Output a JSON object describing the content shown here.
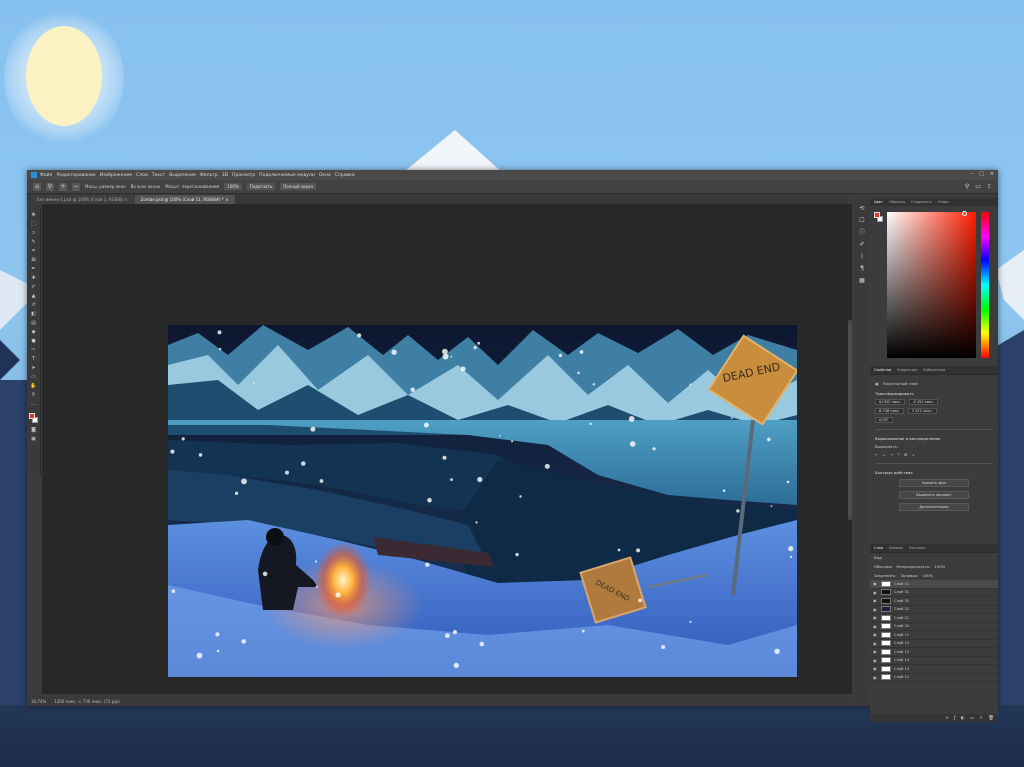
{
  "window": {
    "menu": [
      "Файл",
      "Редактирование",
      "Изображение",
      "Слои",
      "Текст",
      "Выделение",
      "Фильтр",
      "3D",
      "Просмотр",
      "Подключаемые модули",
      "Окно",
      "Справка"
    ],
    "controls": {
      "minimize": "–",
      "maximize": "□",
      "close": "✕"
    }
  },
  "options_bar": {
    "label_1": "Масш. размер окон",
    "label_2": "Во всех окнах",
    "label_3": "Масшт. перетаскиванием",
    "zoom_value": "100%",
    "fit_button": "Подогнать",
    "fill_button": "Полный экран"
  },
  "tabs": [
    {
      "label": "Без имени-1.psd @ 100% (Слой 1, RGB/8) ×",
      "active": false
    },
    {
      "label": "Zombe.psd @ 100% (Слой 11, RGB/8#) * ×",
      "active": true
    }
  ],
  "tools": [
    "move",
    "marquee",
    "lasso",
    "quick-select",
    "crop",
    "frame",
    "eyedropper",
    "heal",
    "brush",
    "stamp",
    "history-brush",
    "eraser",
    "gradient",
    "blur",
    "dodge",
    "pen",
    "type",
    "path-select",
    "shape",
    "hand",
    "zoom",
    "more"
  ],
  "status": {
    "zoom": "16,74%",
    "doc_size": "1300 пикс. × 730 пикс. (72 ppi)"
  },
  "color_panel": {
    "tabs": [
      "Цвет",
      "Образцы",
      "Градиенты",
      "Узоры"
    ],
    "foreground": "#e03a2a",
    "background": "#ffffff"
  },
  "properties_panel": {
    "tabs": [
      "Свойства",
      "Коррекция",
      "Библиотеки"
    ],
    "layer_type": "Пиксельный слой",
    "section_transform": "Трансформировать",
    "w": "Ш 520 пикс.",
    "x": "X 452 пикс.",
    "h": "В 738 пикс.",
    "y": "Y 472 пикс.",
    "angle": "0,00°",
    "section_align": "Выравнивание и распределение",
    "align_label": "Выровнять:",
    "section_quick": "Быстрые действия",
    "btn_remove_bg": "Удалить фон",
    "btn_select_subject": "Выделить предмет",
    "btn_more": "Дополнительно"
  },
  "layers_panel": {
    "tabs": [
      "Слои",
      "Каналы",
      "Контуры"
    ],
    "filter_label": "Вид",
    "blend_mode": "Обычные",
    "opacity_label": "Непрозрачность:",
    "opacity_value": "100%",
    "lock_label": "Закрепить:",
    "fill_label": "Заливка:",
    "fill_value": "100%",
    "layers": [
      {
        "name": "Слой 11",
        "thumb": "white",
        "selected": true
      },
      {
        "name": "Слой 31",
        "thumb": "dark",
        "selected": false
      },
      {
        "name": "Слой 30",
        "thumb": "dark",
        "selected": false
      },
      {
        "name": "Слой 22",
        "thumb": "navy",
        "selected": false
      },
      {
        "name": "Слой 21",
        "thumb": "white",
        "selected": false
      },
      {
        "name": "Слой 20",
        "thumb": "white",
        "selected": false
      },
      {
        "name": "Слой 11",
        "thumb": "white",
        "selected": false
      },
      {
        "name": "Слой 10",
        "thumb": "white",
        "selected": false
      },
      {
        "name": "Слой 15",
        "thumb": "white",
        "selected": false
      },
      {
        "name": "Слой 14",
        "thumb": "white",
        "selected": false
      },
      {
        "name": "Слой 13",
        "thumb": "white",
        "selected": false
      },
      {
        "name": "Слой 12",
        "thumb": "white",
        "selected": false
      }
    ]
  },
  "artwork": {
    "sign_top_text": "DEAD END",
    "sign_bottom_text": "DEAD END"
  }
}
